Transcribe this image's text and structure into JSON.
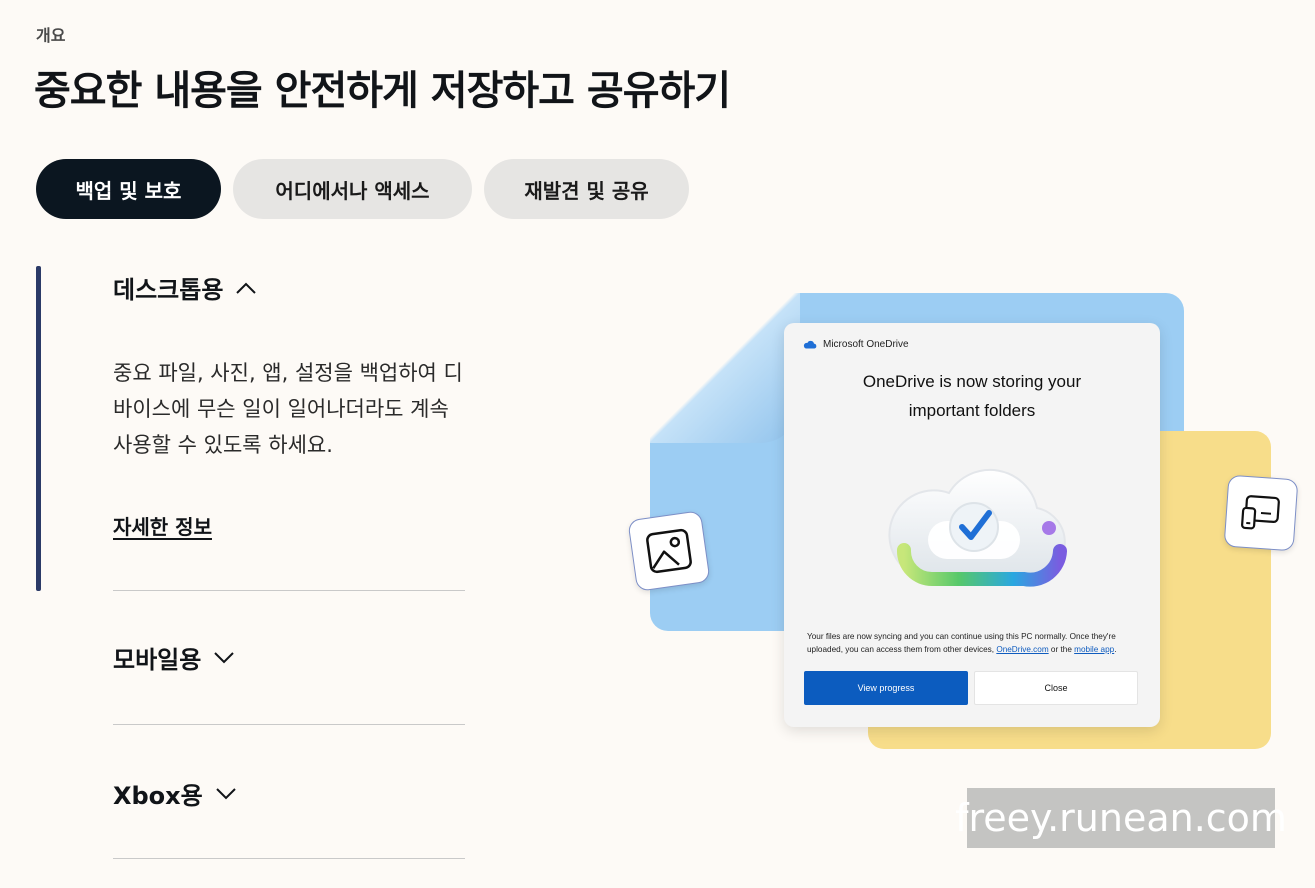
{
  "eyebrow": "개요",
  "title": "중요한 내용을 안전하게 저장하고 공유하기",
  "tabs": [
    {
      "label": "백업 및 보호",
      "active": true
    },
    {
      "label": "어디에서나 액세스",
      "active": false
    },
    {
      "label": "재발견 및 공유",
      "active": false
    }
  ],
  "accordion": {
    "desktop": {
      "heading": "데스크톱용",
      "expanded": true,
      "body": "중요 파일, 사진, 앱, 설정을 백업하여 디바이스에 무슨 일이 일어나더라도 계속 사용할 수 있도록 하세요.",
      "link": "자세한 정보"
    },
    "mobile": {
      "heading": "모바일용",
      "expanded": false
    },
    "xbox": {
      "heading": "Xbox용",
      "expanded": false
    }
  },
  "dialog": {
    "brand": "Microsoft OneDrive",
    "title_line1": "OneDrive is now storing your",
    "title_line2": "important folders",
    "msg_part1": "Your files are now syncing and you can continue using this PC normally. Once they're uploaded, you can access them from other devices, ",
    "msg_link1": "OneDrive.com",
    "msg_part2": " or the ",
    "msg_link2": "mobile app",
    "msg_part3": ".",
    "primary_button": "View progress",
    "secondary_button": "Close"
  },
  "icons": {
    "image_tile": "image-icon",
    "devices_tile": "devices-icon",
    "cloud": "cloud-check-icon"
  },
  "colors": {
    "accent": "#0b1620",
    "primary_button": "#0c5cbf",
    "blue_folder": "#9ccdf3",
    "yellow_card": "#f7dd8a"
  },
  "watermark": "freey.runean.com"
}
